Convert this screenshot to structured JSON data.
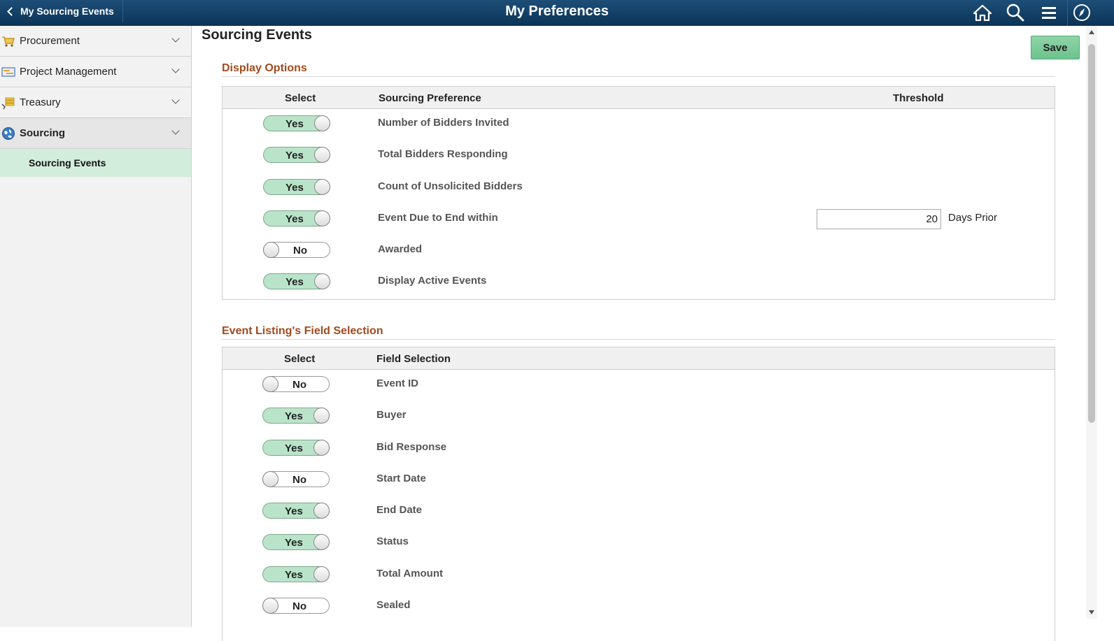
{
  "header": {
    "back_label": "My Sourcing Events",
    "title": "My Preferences",
    "icons": [
      "home-icon",
      "search-icon",
      "menu-icon",
      "navbar-compass-icon"
    ]
  },
  "sidebar": {
    "items": [
      {
        "label": "Procurement",
        "icon": "cart-icon"
      },
      {
        "label": "Project Management",
        "icon": "project-icon"
      },
      {
        "label": "Treasury",
        "icon": "treasury-icon"
      },
      {
        "label": "Sourcing",
        "icon": "globe-icon",
        "active": true
      }
    ],
    "sub_item": "Sourcing Events"
  },
  "main": {
    "title": "Sourcing Events",
    "save_label": "Save",
    "display_options": {
      "title": "Display Options",
      "headers": {
        "select": "Select",
        "preference": "Sourcing Preference",
        "threshold": "Threshold"
      },
      "rows": [
        {
          "toggle": "Yes",
          "on": true,
          "label": "Number of Bidders Invited"
        },
        {
          "toggle": "Yes",
          "on": true,
          "label": "Total Bidders Responding"
        },
        {
          "toggle": "Yes",
          "on": true,
          "label": "Count of Unsolicited Bidders"
        },
        {
          "toggle": "Yes",
          "on": true,
          "label": "Event Due to End within",
          "threshold_value": "20",
          "threshold_unit": "Days Prior"
        },
        {
          "toggle": "No",
          "on": false,
          "label": "Awarded"
        },
        {
          "toggle": "Yes",
          "on": true,
          "label": "Display Active Events"
        }
      ]
    },
    "field_selection": {
      "title": "Event Listing's Field Selection",
      "headers": {
        "select": "Select",
        "field": "Field Selection"
      },
      "rows": [
        {
          "toggle": "No",
          "on": false,
          "label": "Event ID"
        },
        {
          "toggle": "Yes",
          "on": true,
          "label": "Buyer"
        },
        {
          "toggle": "Yes",
          "on": true,
          "label": "Bid Response"
        },
        {
          "toggle": "No",
          "on": false,
          "label": "Start Date"
        },
        {
          "toggle": "Yes",
          "on": true,
          "label": "End Date"
        },
        {
          "toggle": "Yes",
          "on": true,
          "label": "Status"
        },
        {
          "toggle": "Yes",
          "on": true,
          "label": "Total Amount"
        },
        {
          "toggle": "No",
          "on": false,
          "label": "Sealed"
        }
      ]
    }
  },
  "colors": {
    "header": "#0c3356",
    "accent": "#a14a1e",
    "toggle_on": "#b9e4c9",
    "selected_nav": "#d2eddc"
  }
}
